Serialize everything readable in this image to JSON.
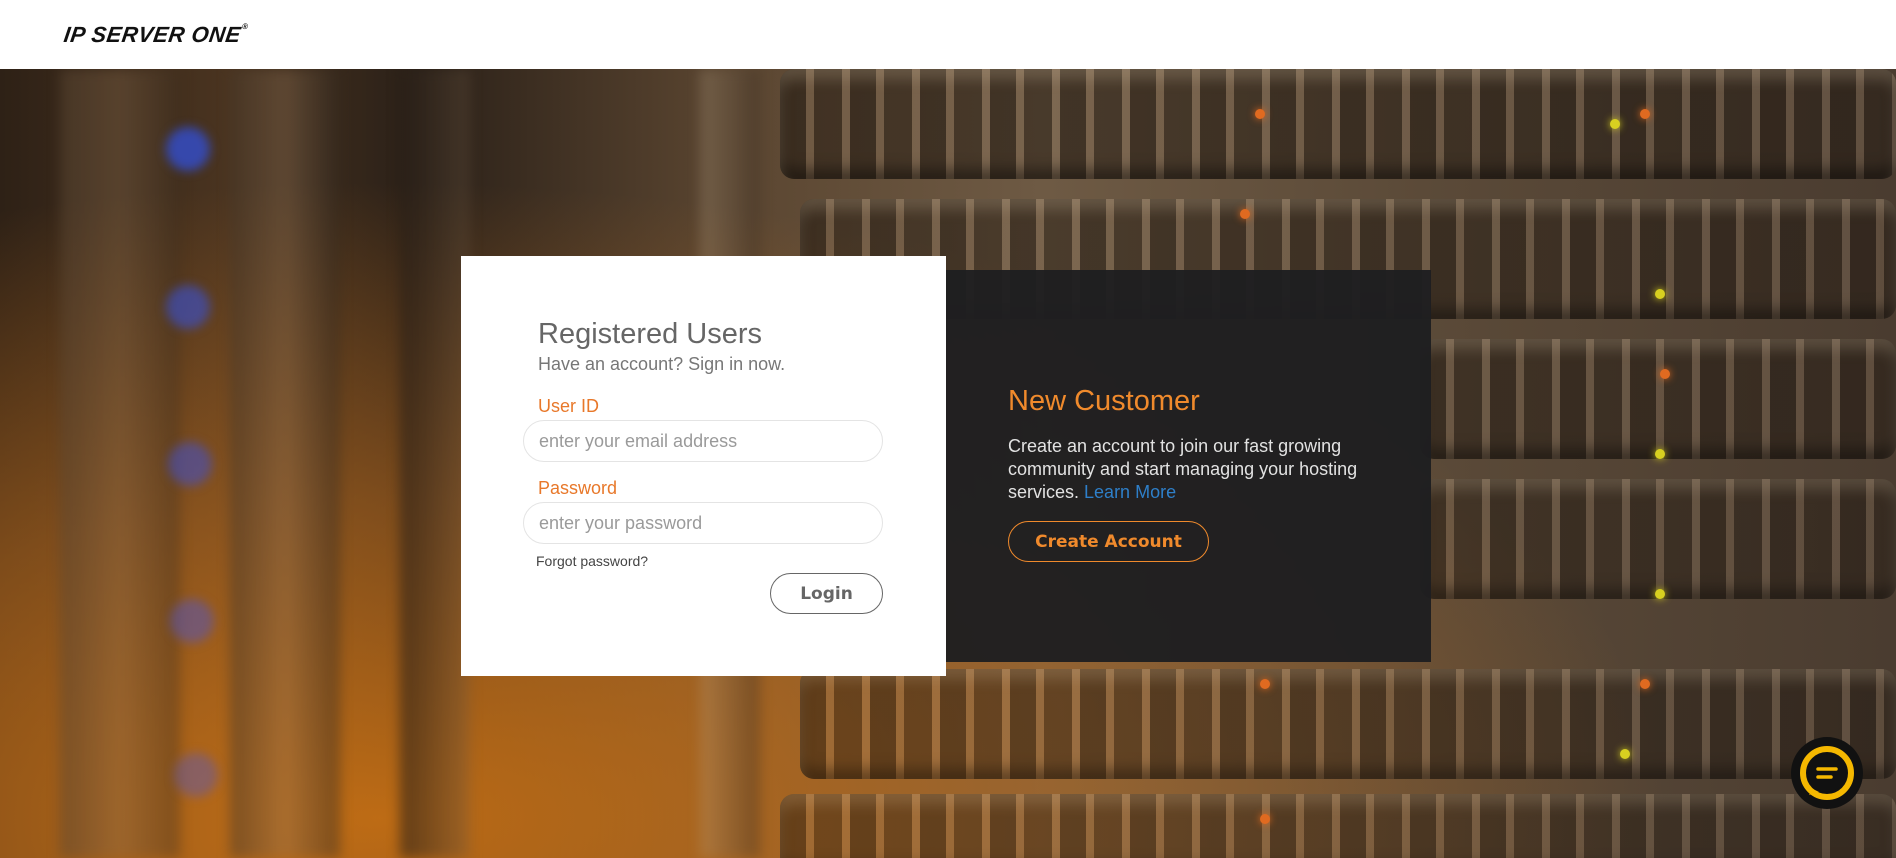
{
  "header": {
    "logo_text": "IP SERVER ONE",
    "logo_mark": "®"
  },
  "login": {
    "title": "Registered Users",
    "subtitle": "Have an account? Sign in now.",
    "user_label": "User ID",
    "user_placeholder": "enter your email address",
    "user_value": "",
    "password_label": "Password",
    "password_placeholder": "enter your password",
    "password_value": "",
    "forgot_link": "Forgot password?",
    "login_button": "Login"
  },
  "new_customer": {
    "title": "New Customer",
    "description": "Create an account to join our fast growing community and start managing your hosting services.",
    "learn_more": "Learn More",
    "create_button": "Create Account"
  },
  "chat": {
    "icon": "chat-bubble-icon"
  },
  "colors": {
    "accent": "#f08a2c",
    "label_orange": "#e8782a",
    "link_blue": "#2e7fc9",
    "dark_panel": "#1e1e20",
    "chat_yellow": "#f5b800"
  }
}
